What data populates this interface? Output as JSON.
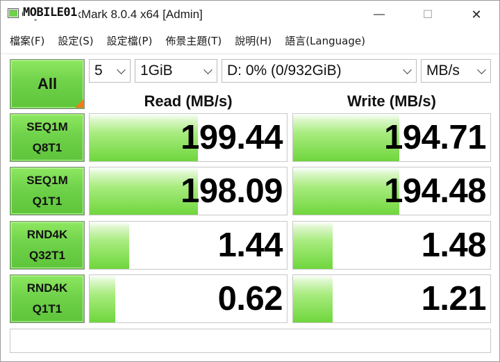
{
  "window": {
    "watermark": "MOBILE01",
    "title": "CrystalDiskMark 8.0.4 x64 [Admin]",
    "minimize": "—",
    "maximize": "☐",
    "close": "✕"
  },
  "menu": {
    "items": [
      "檔案(F)",
      "設定(S)",
      "設定檔(P)",
      "佈景主題(T)",
      "說明(H)",
      "語言(Language)"
    ]
  },
  "controls": {
    "all_label": "All",
    "count": "5",
    "size": "1GiB",
    "drive": "D: 0% (0/932GiB)",
    "unit": "MB/s"
  },
  "headers": {
    "read": "Read (MB/s)",
    "write": "Write (MB/s)"
  },
  "tests": [
    {
      "line1": "SEQ1M",
      "line2": "Q8T1",
      "read": "199.44",
      "write": "194.71",
      "read_fill": 0.55,
      "write_fill": 0.54
    },
    {
      "line1": "SEQ1M",
      "line2": "Q1T1",
      "read": "198.09",
      "write": "194.48",
      "read_fill": 0.55,
      "write_fill": 0.54
    },
    {
      "line1": "RND4K",
      "line2": "Q32T1",
      "read": "1.44",
      "write": "1.48",
      "read_fill": 0.2,
      "write_fill": 0.2
    },
    {
      "line1": "RND4K",
      "line2": "Q1T1",
      "read": "0.62",
      "write": "1.21",
      "read_fill": 0.13,
      "write_fill": 0.2
    }
  ],
  "colors": {
    "accent_green": "#6fd24a",
    "corner_orange": "#f07d1a"
  },
  "status": ""
}
